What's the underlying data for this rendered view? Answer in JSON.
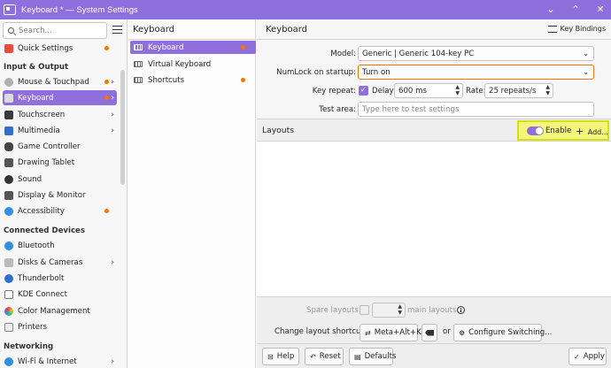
{
  "window": {
    "title": "Keyboard * — System Settings",
    "accent": "#8f6fdc"
  },
  "search": {
    "placeholder": "Search..."
  },
  "sidebar": {
    "items": [
      {
        "label": "Quick Settings",
        "dot": true
      },
      {
        "label": "Mouse & Touchpad",
        "dot": true,
        "chevron": true
      },
      {
        "label": "Keyboard",
        "dot": true,
        "chevron": true,
        "selected": true
      },
      {
        "label": "Touchscreen",
        "chevron": true
      },
      {
        "label": "Multimedia",
        "chevron": true
      },
      {
        "label": "Game Controller"
      },
      {
        "label": "Drawing Tablet"
      },
      {
        "label": "Sound"
      },
      {
        "label": "Display & Monitor"
      },
      {
        "label": "Accessibility",
        "dot": true
      },
      {
        "label": "Bluetooth"
      },
      {
        "label": "Disks & Cameras",
        "chevron": true
      },
      {
        "label": "Thunderbolt"
      },
      {
        "label": "KDE Connect"
      },
      {
        "label": "Color Management"
      },
      {
        "label": "Printers"
      },
      {
        "label": "Wi-Fi & Internet",
        "chevron": true
      }
    ],
    "sections": [
      "Input & Output",
      "Connected Devices",
      "Networking"
    ]
  },
  "subpanel": {
    "title": "Keyboard",
    "items": [
      {
        "label": "Keyboard",
        "dot": true,
        "selected": true
      },
      {
        "label": "Virtual Keyboard"
      },
      {
        "label": "Shortcuts",
        "dot": true
      }
    ]
  },
  "main": {
    "title": "Keyboard",
    "key_bindings": "Key Bindings",
    "model_label": "Model:",
    "model_value": "Generic | Generic 104-key PC",
    "numlock_label": "NumLock on startup:",
    "numlock_value": "Turn on",
    "repeat_label": "Key repeat:",
    "delay_label": "Delay:",
    "delay_value": "600 ms",
    "rate_label": "Rate:",
    "rate_value": "25 repeats/s",
    "test_label": "Test area:",
    "test_placeholder": "Type here to test settings",
    "layouts_label": "Layouts",
    "enable_label": "Enable",
    "add_label": "Add...",
    "spare_label": "Spare layouts:",
    "main_layouts": "main layouts",
    "shortcut_label": "Change layout shortcut:",
    "shortcut_value": "Meta+Alt+K",
    "or_label": "or",
    "configure_label": "Configure Switching...",
    "help": "Help",
    "reset": "Reset",
    "defaults": "Defaults",
    "apply": "Apply"
  }
}
